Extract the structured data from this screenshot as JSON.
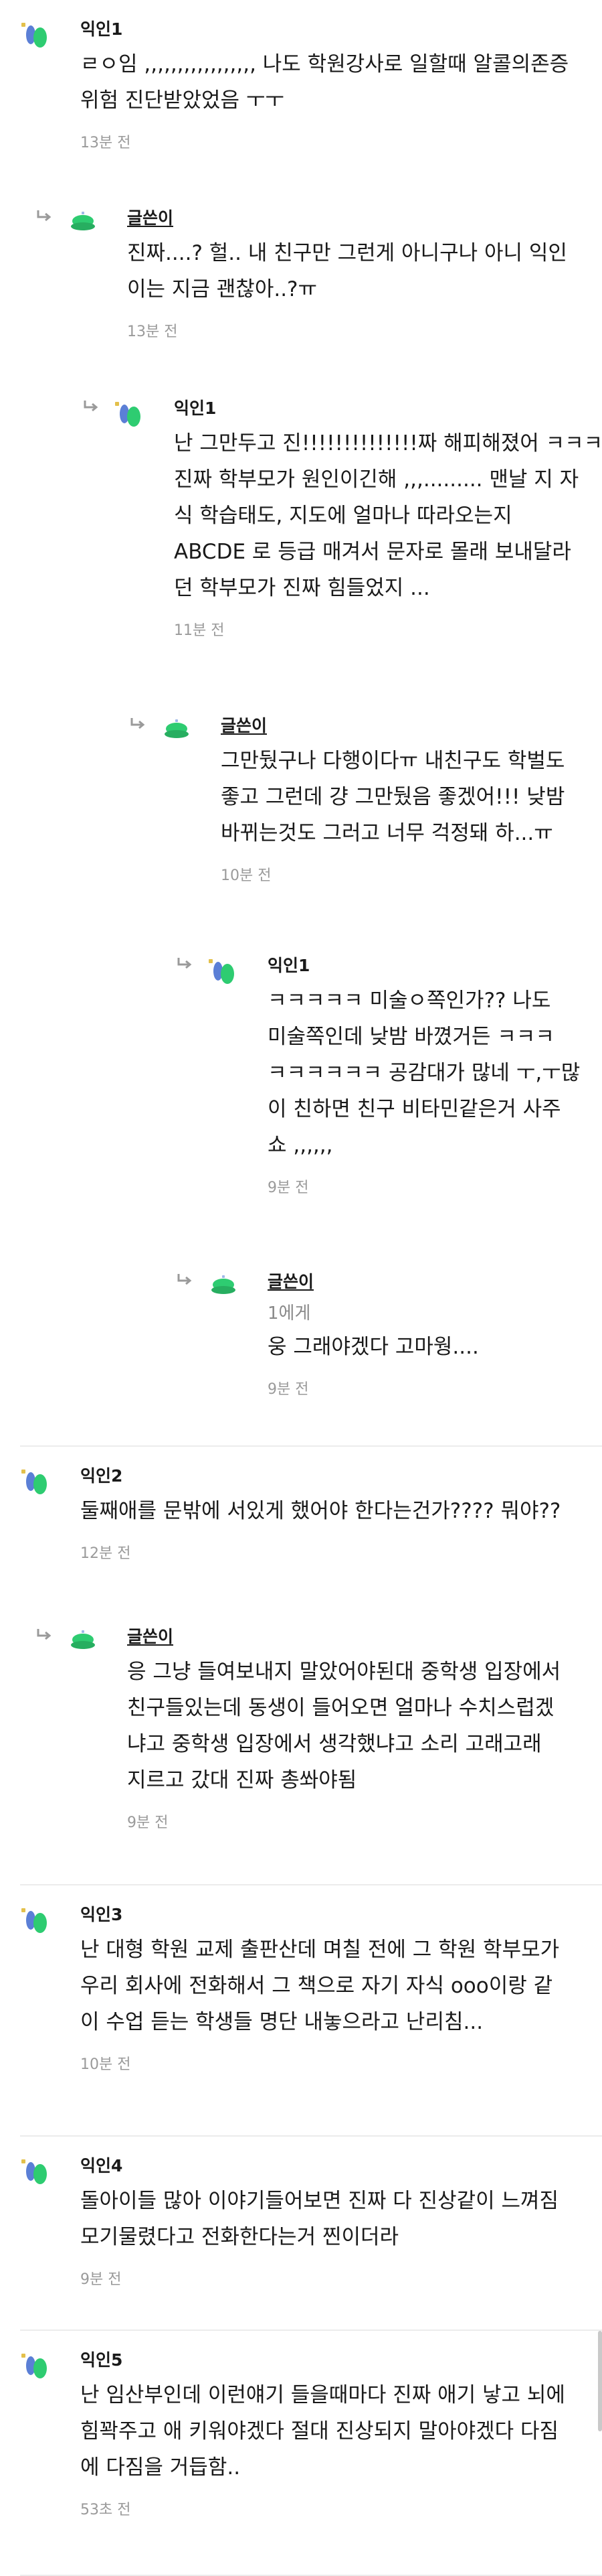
{
  "comments": [
    {
      "author": "익인1",
      "author_is_op": false,
      "depth": 0,
      "mention": "",
      "lines": [
        "ㄹㅇ임 ,,,,,,,,,,,,,,,,, 나도 학원강사로 일할때 알콜의존증",
        "위험 진단받았었음 ㅜㅜ"
      ],
      "time": "13분 전",
      "avatar_icon": "user-avatar-icon"
    },
    {
      "author": "글쓴이",
      "author_is_op": true,
      "depth": 1,
      "mention": "",
      "lines": [
        "진짜....? 헐.. 내 친구만 그런게 아니구나 아니 익인",
        "이는 지금 괜찮아..?ㅠ"
      ],
      "time": "13분 전",
      "avatar_icon": "user-avatar-icon"
    },
    {
      "author": "익인1",
      "author_is_op": false,
      "depth": 2,
      "mention": "",
      "lines": [
        "난 그만두고 진!!!!!!!!!!!!!!짜 해피해졌어 ㅋㅋㅋ",
        "진짜 학부모가 원인이긴해 ,,,......... 맨날 지 자",
        "식 학습태도, 지도에 얼마나 따라오는지",
        "ABCDE 로 등급 매겨서 문자로 몰래 보내달라",
        "던 학부모가 진짜 힘들었지 ..."
      ],
      "time": "11분 전",
      "avatar_icon": "user-avatar-icon"
    },
    {
      "author": "글쓴이",
      "author_is_op": true,
      "depth": 3,
      "mention": "",
      "lines": [
        "그만뒀구나 다행이다ㅠ 내친구도 학벌도",
        "좋고 그런데 걍 그만뒀음 좋겠어!!! 낮밤",
        "바뀌는것도 그러고 너무 걱정돼 하...ㅠ"
      ],
      "time": "10분 전",
      "avatar_icon": "user-avatar-icon"
    },
    {
      "author": "익인1",
      "author_is_op": false,
      "depth": 4,
      "mention": "",
      "lines": [
        "ㅋㅋㅋㅋㅋ 미술ㅇ쪽인가?? 나도",
        "미술쪽인데 낮밤 바꼈거든 ㅋㅋㅋ",
        "ㅋㅋㅋㅋㅋㅋ 공감대가 많네 ㅜ,ㅜ많",
        "이 친하면 친구 비타민같은거 사주",
        "쇼 ,,,,,,"
      ],
      "time": "9분 전",
      "avatar_icon": "user-avatar-icon"
    },
    {
      "author": "글쓴이",
      "author_is_op": true,
      "depth": 4,
      "mention": "1에게",
      "lines": [
        "웅 그래야겠다 고마웡...."
      ],
      "time": "9분 전",
      "avatar_icon": "user-avatar-icon"
    },
    {
      "author": "익인2",
      "author_is_op": false,
      "depth": 0,
      "mention": "",
      "lines": [
        "둘째애를 문밖에 서있게 했어야 한다는건가???? 뭐야??"
      ],
      "time": "12분 전",
      "avatar_icon": "user-avatar-icon"
    },
    {
      "author": "글쓴이",
      "author_is_op": true,
      "depth": 1,
      "mention": "",
      "lines": [
        "응 그냥 들여보내지 말았어야된대 중학생 입장에서",
        "친구들있는데 동생이 들어오면 얼마나 수치스럽겠",
        "냐고 중학생 입장에서 생각했냐고 소리 고래고래",
        "지르고 갔대 진짜 총쏴야됨"
      ],
      "time": "9분 전",
      "avatar_icon": "user-avatar-icon"
    },
    {
      "author": "익인3",
      "author_is_op": false,
      "depth": 0,
      "mention": "",
      "lines": [
        "난 대형 학원 교제 출판산데 며칠 전에 그 학원 학부모가",
        "우리 회사에 전화해서 그 책으로 자기 자식 ooo이랑 같",
        "이 수업 듣는 학생들 명단 내놓으라고 난리침..."
      ],
      "time": "10분 전",
      "avatar_icon": "user-avatar-icon"
    },
    {
      "author": "익인4",
      "author_is_op": false,
      "depth": 0,
      "mention": "",
      "lines": [
        "돌아이들 많아 이야기들어보면 진짜 다 진상같이 느껴짐",
        "모기물렸다고 전화한다는거 찐이더라"
      ],
      "time": "9분 전",
      "avatar_icon": "user-avatar-icon"
    },
    {
      "author": "익인5",
      "author_is_op": false,
      "depth": 0,
      "mention": "",
      "lines": [
        "난 임산부인데 이런얘기 들을때마다 진짜 애기 낳고 뇌에",
        "힘꽉주고 애 키워야겠다 절대 진상되지 말아야겠다 다짐",
        "에 다짐을 거듭함.."
      ],
      "time": "53초 전",
      "avatar_icon": "user-avatar-icon"
    }
  ],
  "colors": {
    "green": "#2ecc71",
    "blue": "#5b7fd6",
    "gray_meta": "#9a9a9a",
    "divider": "#ececec"
  }
}
